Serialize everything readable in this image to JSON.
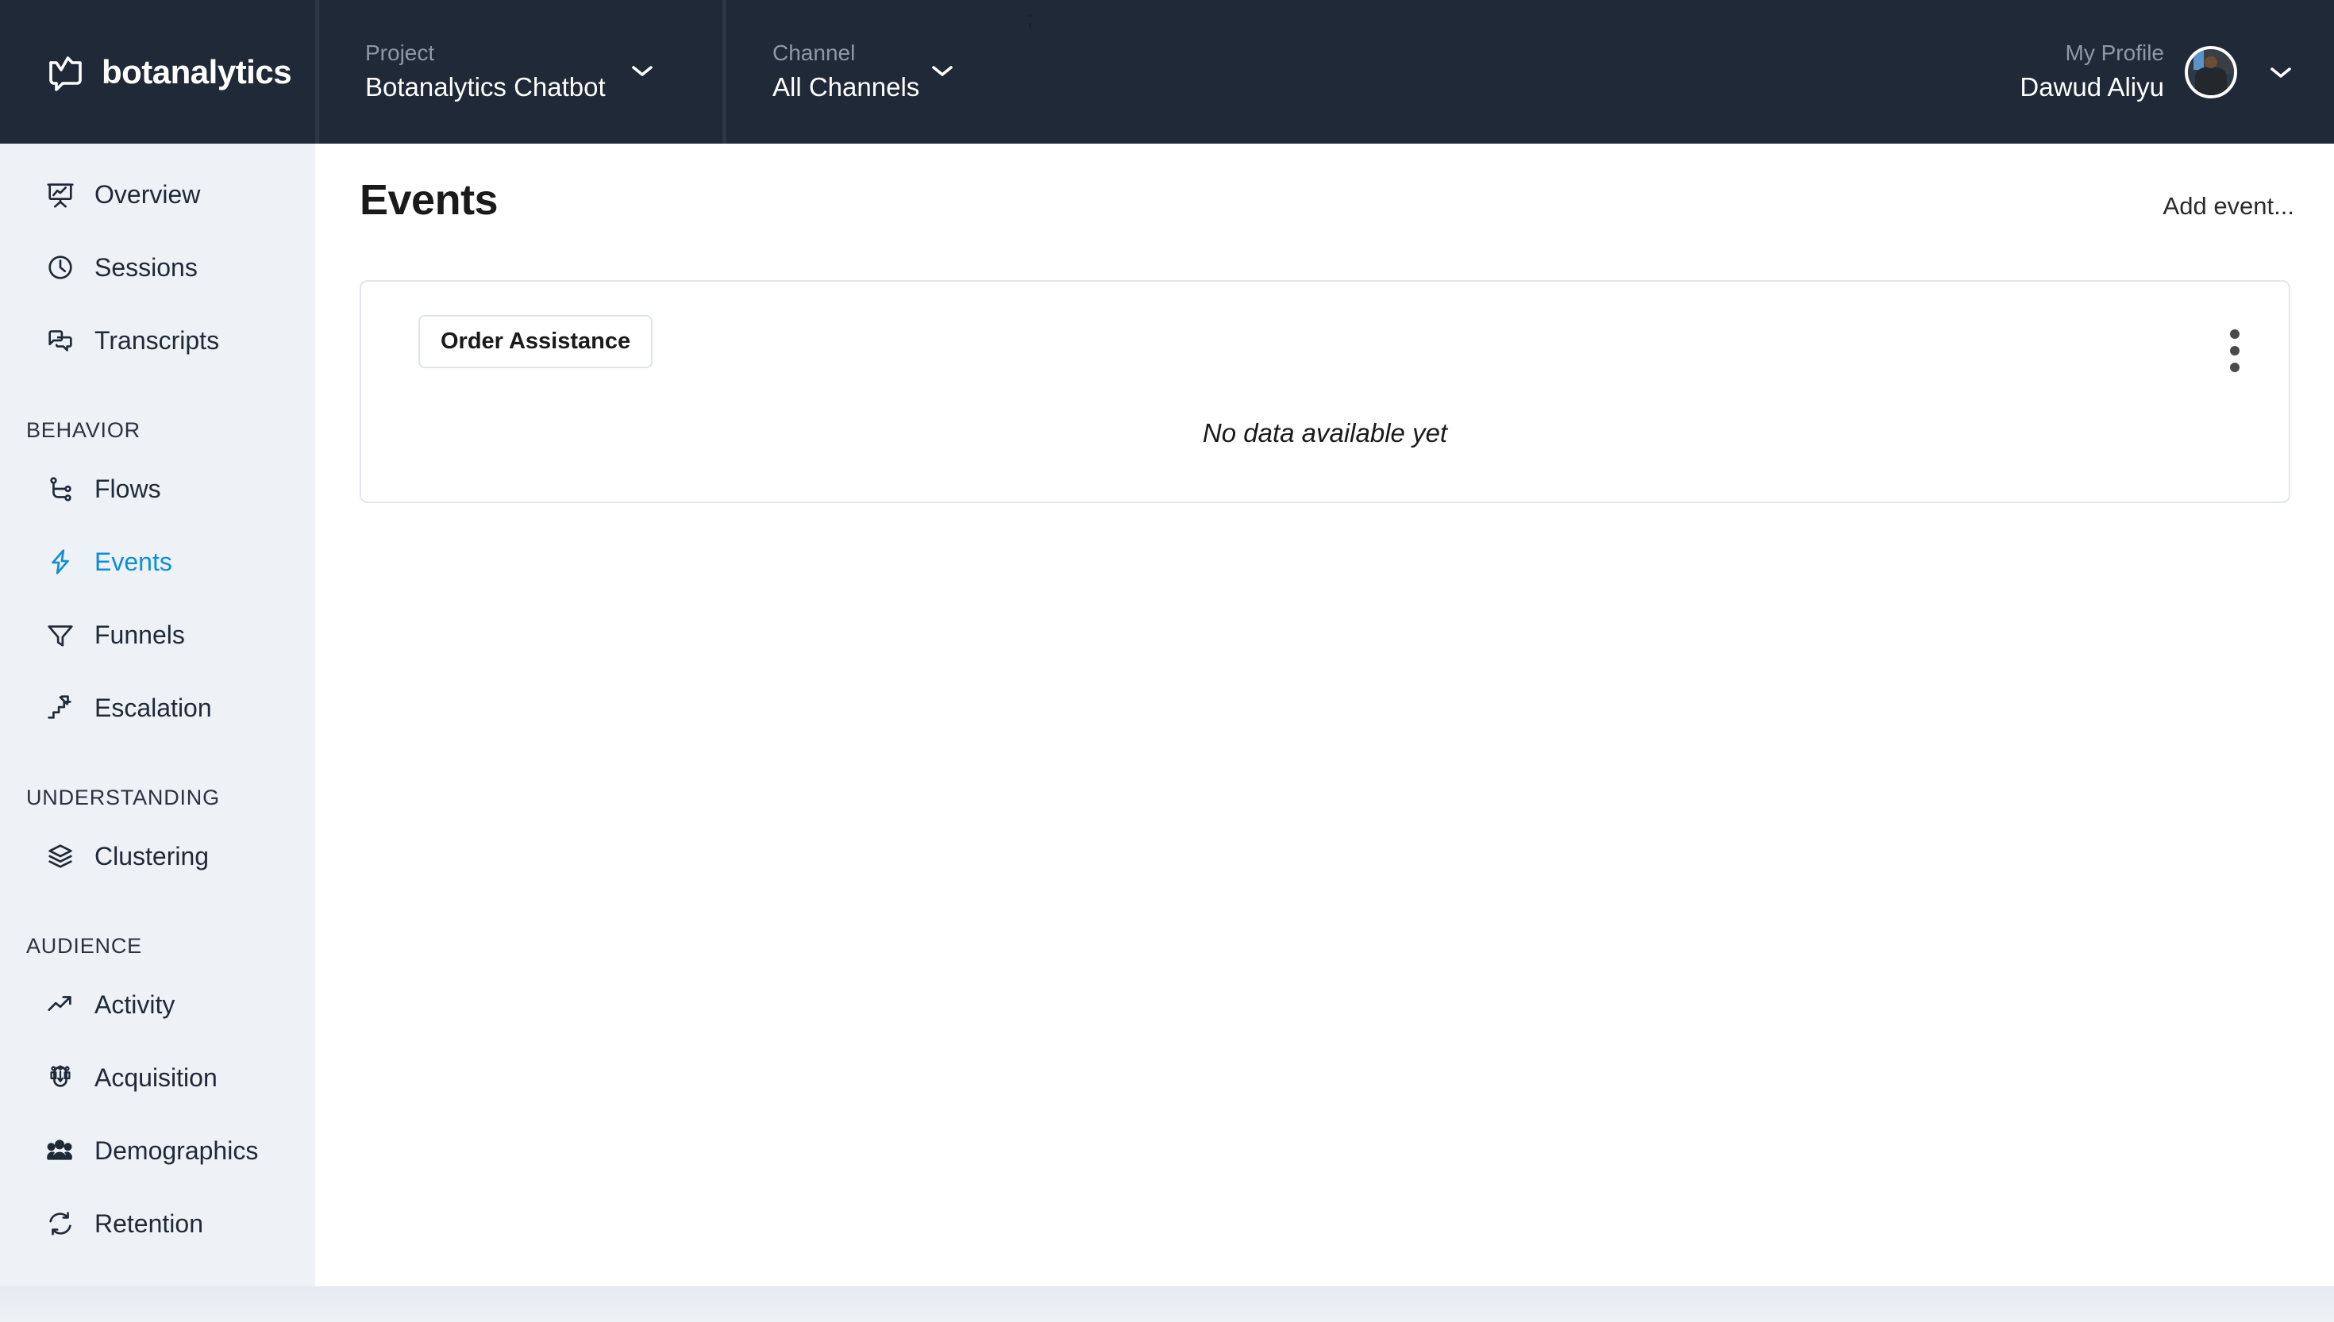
{
  "brand": {
    "name": "botanalytics",
    "logo_icon": "chat-chart-logo-icon"
  },
  "header": {
    "project": {
      "label": "Project",
      "value": "Botanalytics Chatbot",
      "chevron_icon": "chevron-down-icon"
    },
    "channel": {
      "label": "Channel",
      "value": "All Channels",
      "chevron_icon": "chevron-down-icon"
    },
    "profile": {
      "label": "My Profile",
      "value": "Dawud Aliyu",
      "avatar_icon": "user-avatar-photo",
      "chevron_icon": "chevron-down-icon"
    },
    "drag_handle": ";",
    "background_color": "#1f2937"
  },
  "sidebar": {
    "background_color": "#eef1f6",
    "active_color": "#0c8fd8",
    "groups": [
      {
        "title": null,
        "items": [
          {
            "label": "Overview",
            "icon": "presentation-chart-icon",
            "active": false
          },
          {
            "label": "Sessions",
            "icon": "clock-icon",
            "active": false
          },
          {
            "label": "Transcripts",
            "icon": "chat-bubbles-icon",
            "active": false
          }
        ]
      },
      {
        "title": "BEHAVIOR",
        "items": [
          {
            "label": "Flows",
            "icon": "flow-branch-icon",
            "active": false
          },
          {
            "label": "Events",
            "icon": "lightning-bolt-icon",
            "active": true
          },
          {
            "label": "Funnels",
            "icon": "funnel-icon",
            "active": false
          },
          {
            "label": "Escalation",
            "icon": "stairs-arrow-up-icon",
            "active": false
          }
        ]
      },
      {
        "title": "UNDERSTANDING",
        "items": [
          {
            "label": "Clustering",
            "icon": "layers-stack-icon",
            "active": false
          }
        ]
      },
      {
        "title": "AUDIENCE",
        "items": [
          {
            "label": "Activity",
            "icon": "trend-arrow-up-icon",
            "active": false
          },
          {
            "label": "Acquisition",
            "icon": "magnet-people-icon",
            "active": false
          },
          {
            "label": "Demographics",
            "icon": "people-group-icon",
            "active": false
          },
          {
            "label": "Retention",
            "icon": "refresh-cycle-icon",
            "active": false
          }
        ]
      }
    ]
  },
  "main": {
    "page_title": "Events",
    "add_event_label": "Add event...",
    "card": {
      "chip_label": "Order Assistance",
      "kebab_icon": "more-vertical-icon",
      "empty_message": "No data available yet"
    }
  }
}
